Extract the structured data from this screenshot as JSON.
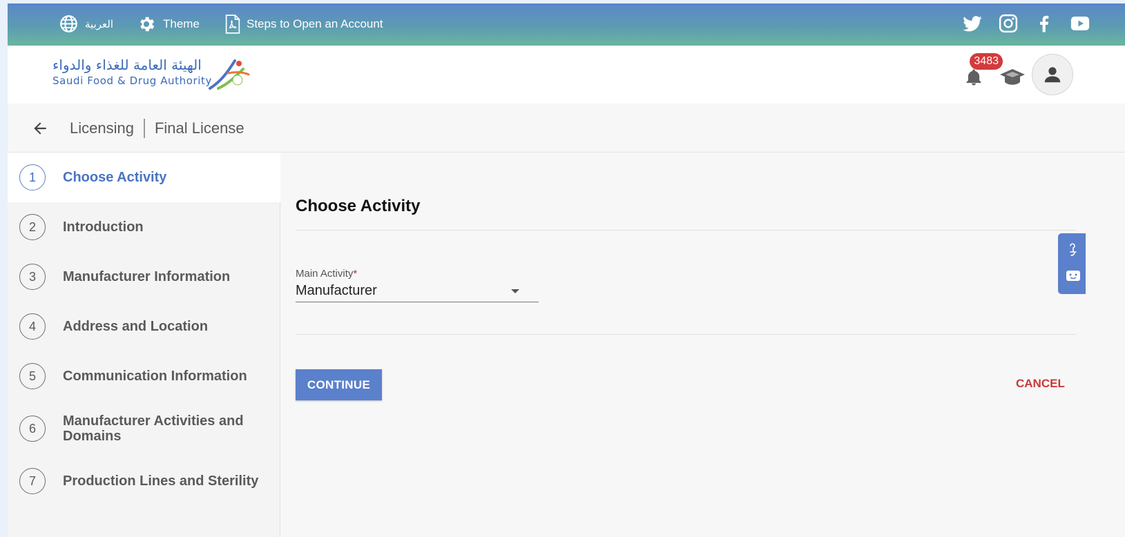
{
  "topbar": {
    "language_label": "العربية",
    "theme_label": "Theme",
    "steps_label": "Steps to Open an Account",
    "social_icons": [
      "twitter-icon",
      "instagram-icon",
      "facebook-icon",
      "youtube-icon"
    ]
  },
  "header": {
    "logo_arabic": "الهيئة العامة للغذاء والدواء",
    "logo_english": "Saudi Food & Drug Authority",
    "notification_count": "3483"
  },
  "breadcrumb": {
    "section": "Licensing",
    "page": "Final License"
  },
  "steps": [
    {
      "num": "1",
      "label": "Choose Activity"
    },
    {
      "num": "2",
      "label": "Introduction"
    },
    {
      "num": "3",
      "label": "Manufacturer Information"
    },
    {
      "num": "4",
      "label": "Address and Location"
    },
    {
      "num": "5",
      "label": "Communication Information"
    },
    {
      "num": "6",
      "label": "Manufacturer Activities and Domains"
    },
    {
      "num": "7",
      "label": "Production Lines and Sterility"
    }
  ],
  "form": {
    "title": "Choose Activity",
    "main_activity_label": "Main Activity",
    "required_mark": "*",
    "main_activity_value": "Manufacturer",
    "continue_label": "CONTINUE",
    "cancel_label": "CANCEL"
  },
  "colors": {
    "primary": "#5b80cc",
    "danger": "#c73a3a",
    "badge": "#d23b3b"
  }
}
